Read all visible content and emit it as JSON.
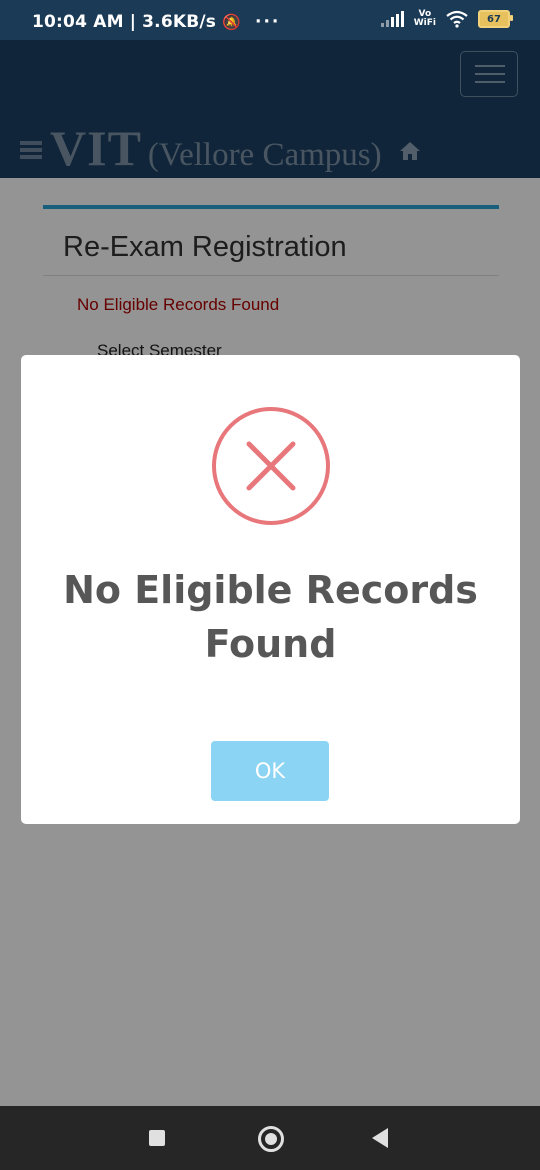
{
  "status_bar": {
    "time": "10:04 AM",
    "speed": "3.6KB/s",
    "more": "···",
    "vowifi_top": "Vo",
    "vowifi_bottom": "WiFi",
    "battery": "67"
  },
  "header": {
    "brand_main": "VIT",
    "brand_sub": "(Vellore Campus)"
  },
  "panel": {
    "title": "Re-Exam Registration",
    "error": "No Eligible Records Found",
    "label": "Select Semester"
  },
  "modal": {
    "title_line1": "No Eligible Records",
    "title_line2": "Found",
    "ok_label": "OK",
    "icon": "error-x-icon",
    "icon_color": "#e8777b",
    "button_color": "#8cd4f3"
  }
}
